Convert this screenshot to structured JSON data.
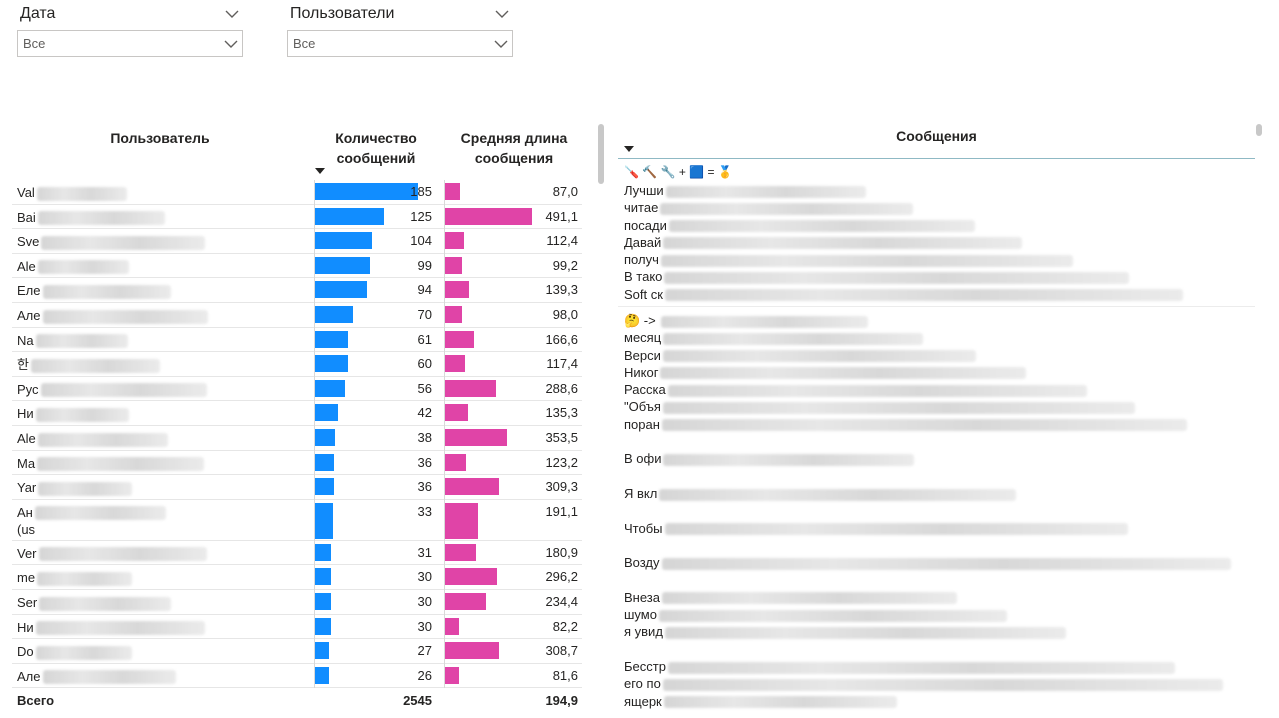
{
  "filters": {
    "date": {
      "title": "Дата",
      "value": "Все"
    },
    "users": {
      "title": "Пользователи",
      "value": "Все"
    }
  },
  "table": {
    "headers": {
      "user": "Пользователь",
      "count": "Количество сообщений",
      "avg_len": "Средняя длина сообщения"
    },
    "rows": [
      {
        "user": "Val",
        "count": "185",
        "avg_len": "87,0"
      },
      {
        "user": "Bai",
        "count": "125",
        "avg_len": "491,1"
      },
      {
        "user": "Sve",
        "count": "104",
        "avg_len": "112,4"
      },
      {
        "user": "Ale",
        "count": "99",
        "avg_len": "99,2"
      },
      {
        "user": "Еле",
        "count": "94",
        "avg_len": "139,3"
      },
      {
        "user": "Але",
        "count": "70",
        "avg_len": "98,0"
      },
      {
        "user": "Na",
        "count": "61",
        "avg_len": "166,6"
      },
      {
        "user": "한",
        "count": "60",
        "avg_len": "117,4"
      },
      {
        "user": "Рус",
        "count": "56",
        "avg_len": "288,6"
      },
      {
        "user": "Ни",
        "count": "42",
        "avg_len": "135,3"
      },
      {
        "user": "Ale",
        "count": "38",
        "avg_len": "353,5"
      },
      {
        "user": "Ma",
        "count": "36",
        "avg_len": "123,2"
      },
      {
        "user": "Yar",
        "count": "36",
        "avg_len": "309,3"
      },
      {
        "user": "Ан",
        "user2": "(us",
        "count": "33",
        "avg_len": "191,1"
      },
      {
        "user": "Ver",
        "count": "31",
        "avg_len": "180,9"
      },
      {
        "user": "me",
        "count": "30",
        "avg_len": "296,2"
      },
      {
        "user": "Ser",
        "count": "30",
        "avg_len": "234,4"
      },
      {
        "user": "Ни",
        "count": "30",
        "avg_len": "82,2"
      },
      {
        "user": "Do",
        "count": "27",
        "avg_len": "308,7"
      },
      {
        "user": "Але",
        "count": "26",
        "avg_len": "81,6"
      }
    ],
    "totals": {
      "label": "Всего",
      "count": "2545",
      "avg_len": "194,9"
    }
  },
  "chart_data": {
    "type": "bar",
    "categories": [
      "Val",
      "Bai",
      "Sve",
      "Ale",
      "Еле",
      "Але",
      "Na",
      "한",
      "Рус",
      "Ни",
      "Ale",
      "Ma",
      "Yar",
      "Ан (us",
      "Ver",
      "me",
      "Ser",
      "Ни",
      "Do",
      "Але"
    ],
    "series": [
      {
        "name": "Количество сообщений",
        "values": [
          185,
          125,
          104,
          99,
          94,
          70,
          61,
          60,
          56,
          42,
          38,
          36,
          36,
          33,
          31,
          30,
          30,
          30,
          27,
          26
        ]
      },
      {
        "name": "Средняя длина сообщения",
        "values": [
          87.0,
          491.1,
          112.4,
          99.2,
          139.3,
          98.0,
          166.6,
          117.4,
          288.6,
          135.3,
          353.5,
          123.2,
          309.3,
          191.1,
          180.9,
          296.2,
          234.4,
          82.2,
          308.7,
          81.6
        ]
      }
    ],
    "colors": {
      "count": "#118dff",
      "avg_len": "#e044a7"
    }
  },
  "messages": {
    "title": "Сообщения",
    "emoji_line": "🪛 🔨 🔧  +  🟦 = 🥇",
    "blocks": [
      {
        "lines": [
          "Лучши",
          "читае",
          "посади",
          "Давай",
          "получ",
          "В тако",
          "Soft ск"
        ]
      },
      {
        "lines": [
          "🤔 -> ",
          "месяц",
          "Верси",
          "Никог",
          "Расска",
          "\"Объя",
          "поран",
          "",
          "В офи",
          "",
          "Я вкл",
          "",
          "Чтобы",
          "",
          "Возду",
          "",
          "Внеза",
          "шумо",
          "я увид",
          "",
          "Бесстр",
          "его по",
          "ящерк"
        ]
      }
    ]
  }
}
